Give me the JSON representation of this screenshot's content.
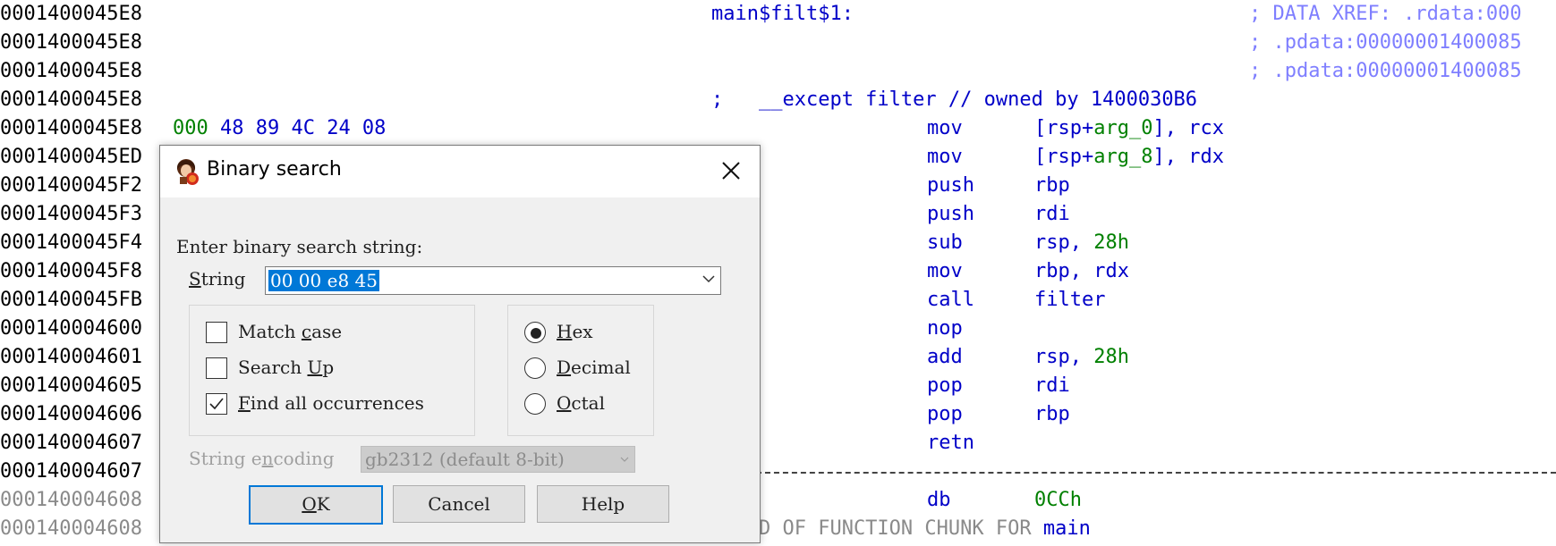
{
  "listing": {
    "rows": [
      {
        "addr": "0001400045E8",
        "gray": false,
        "bytes": "",
        "label": "main$filt$1:",
        "mnem": "",
        "ops": "",
        "comment": "; DATA XREF: .rdata:000"
      },
      {
        "addr": "0001400045E8",
        "gray": false,
        "bytes": "",
        "label": "",
        "mnem": "",
        "ops": "",
        "comment": "; .pdata:00000001400085"
      },
      {
        "addr": "0001400045E8",
        "gray": false,
        "bytes": "",
        "label": "",
        "mnem": "",
        "ops": "",
        "comment": "; .pdata:00000001400085"
      },
      {
        "addr": "0001400045E8",
        "gray": false,
        "bytes": "",
        "label": "",
        "mnem": "",
        "ops": "",
        "comment": ""
      },
      {
        "addr": "0001400045E8",
        "gray": false,
        "bytes": "",
        "label": "",
        "mnem": "mov",
        "ops": "",
        "comment": ""
      },
      {
        "addr": "0001400045ED",
        "gray": false,
        "bytes": "",
        "label": "",
        "mnem": "mov",
        "ops": "",
        "comment": ""
      },
      {
        "addr": "0001400045F2",
        "gray": false,
        "bytes": "",
        "label": "",
        "mnem": "push",
        "ops": "rbp",
        "comment": ""
      },
      {
        "addr": "0001400045F3",
        "gray": false,
        "bytes": "",
        "label": "",
        "mnem": "push",
        "ops": "rdi",
        "comment": ""
      },
      {
        "addr": "0001400045F4",
        "gray": false,
        "bytes": "",
        "label": "",
        "mnem": "sub",
        "ops": "",
        "comment": ""
      },
      {
        "addr": "0001400045F8",
        "gray": false,
        "bytes": "",
        "label": "",
        "mnem": "mov",
        "ops": "rbp, rdx",
        "comment": ""
      },
      {
        "addr": "0001400045FB",
        "gray": false,
        "bytes": "",
        "label": "",
        "mnem": "call",
        "ops": "filter",
        "comment": ""
      },
      {
        "addr": "000140004600",
        "gray": false,
        "bytes": "",
        "label": "",
        "mnem": "nop",
        "ops": "",
        "comment": ""
      },
      {
        "addr": "000140004601",
        "gray": false,
        "bytes": "",
        "label": "",
        "mnem": "add",
        "ops": "",
        "comment": ""
      },
      {
        "addr": "000140004605",
        "gray": false,
        "bytes": "",
        "label": "",
        "mnem": "pop",
        "ops": "rdi",
        "comment": ""
      },
      {
        "addr": "000140004606",
        "gray": false,
        "bytes": "",
        "label": "",
        "mnem": "pop",
        "ops": "rbp",
        "comment": ""
      },
      {
        "addr": "000140004607",
        "gray": false,
        "bytes": "",
        "label": "",
        "mnem": "retn",
        "ops": "",
        "comment": ""
      },
      {
        "addr": "000140004607",
        "gray": false,
        "bytes": "",
        "label": "",
        "mnem": "",
        "ops": "",
        "comment": ""
      },
      {
        "addr": "000140004608",
        "gray": true,
        "bytes": "",
        "label": "",
        "mnem": "db",
        "ops": "",
        "comment": ""
      },
      {
        "addr": "000140004608",
        "gray": true,
        "bytes": "",
        "label": "",
        "mnem": "",
        "ops": "",
        "comment": ""
      }
    ],
    "bytes_row4_green": "000",
    "bytes_row4_blue": "48 89 4C 24 08",
    "except_line": ";   __except filter // owned by 1400030B6",
    "row4_ops_a": "[rsp+",
    "row4_ops_b": "arg_0",
    "row4_ops_c": "], rcx",
    "row5_ops_a": "[rsp+",
    "row5_ops_b": "arg_8",
    "row5_ops_c": "], rdx",
    "row8_ops_a": "rsp, ",
    "row8_ops_b": "28h",
    "row12_ops_a": "rsp, ",
    "row12_ops_b": "28h",
    "row17_ops_b": "0CCh",
    "end_chunk_a": "; END OF FUNCTION CHUNK FOR ",
    "end_chunk_b": "main"
  },
  "dialog": {
    "title": "Binary search",
    "prompt": "Enter binary search string:",
    "string_label_u": "S",
    "string_label_rest": "tring",
    "string_value": "00 00 e8 45",
    "options": {
      "match_case": {
        "pre": "Match ",
        "u": "c",
        "post": "ase",
        "checked": false
      },
      "search_up": {
        "pre": "Search ",
        "u": "U",
        "post": "p",
        "checked": false
      },
      "find_all": {
        "pre": "",
        "u": "F",
        "post": "ind all occurrences",
        "checked": true
      }
    },
    "radix": {
      "hex": {
        "u": "H",
        "post": "ex",
        "selected": true
      },
      "decimal": {
        "u": "D",
        "post": "ecimal",
        "selected": false
      },
      "octal": {
        "u": "O",
        "post": "ctal",
        "selected": false
      }
    },
    "encoding_label_pre": "String e",
    "encoding_label_u": "n",
    "encoding_label_post": "coding",
    "encoding_value": "gb2312 (default 8-bit)",
    "buttons": {
      "ok_u": "O",
      "ok_post": "K",
      "cancel": "Cancel",
      "help": "Help"
    }
  },
  "colors": {
    "accent": "#0078d7",
    "listing_blue": "#0000c8",
    "listing_green": "#008000",
    "comment": "#7f7fff"
  }
}
